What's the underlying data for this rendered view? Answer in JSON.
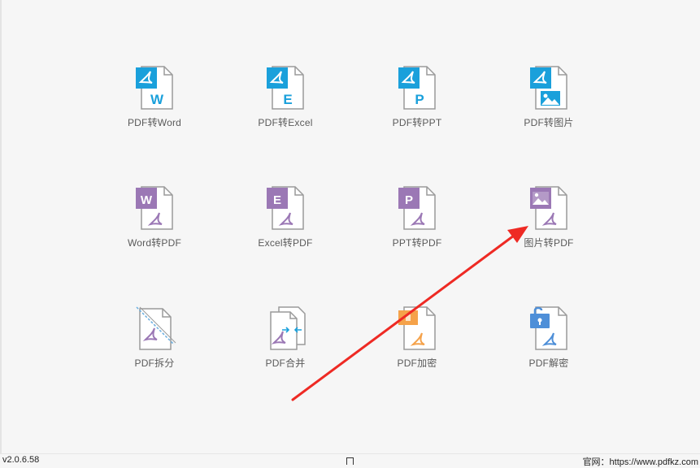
{
  "tools": [
    {
      "label": "PDF转Word",
      "icon": "pdf-to-word-icon",
      "letter": "W"
    },
    {
      "label": "PDF转Excel",
      "icon": "pdf-to-excel-icon",
      "letter": "E"
    },
    {
      "label": "PDF转PPT",
      "icon": "pdf-to-ppt-icon",
      "letter": "P"
    },
    {
      "label": "PDF转图片",
      "icon": "pdf-to-image-icon",
      "letter": ""
    },
    {
      "label": "Word转PDF",
      "icon": "word-to-pdf-icon",
      "letter": "W"
    },
    {
      "label": "Excel转PDF",
      "icon": "excel-to-pdf-icon",
      "letter": "E"
    },
    {
      "label": "PPT转PDF",
      "icon": "ppt-to-pdf-icon",
      "letter": "P"
    },
    {
      "label": "图片转PDF",
      "icon": "image-to-pdf-icon",
      "letter": ""
    },
    {
      "label": "PDF拆分",
      "icon": "pdf-split-icon",
      "letter": ""
    },
    {
      "label": "PDF合并",
      "icon": "pdf-merge-icon",
      "letter": ""
    },
    {
      "label": "PDF加密",
      "icon": "pdf-encrypt-icon",
      "letter": ""
    },
    {
      "label": "PDF解密",
      "icon": "pdf-decrypt-icon",
      "letter": ""
    }
  ],
  "status": {
    "version": "v2.0.6.58",
    "website": "官网：https://www.pdfkz.com"
  },
  "colors": {
    "blue": "#1aa0db",
    "purple": "#9b78b5",
    "orange": "#f5a24a",
    "lightblue": "#4e8fd8",
    "annotation_arrow": "#ee2a24"
  }
}
